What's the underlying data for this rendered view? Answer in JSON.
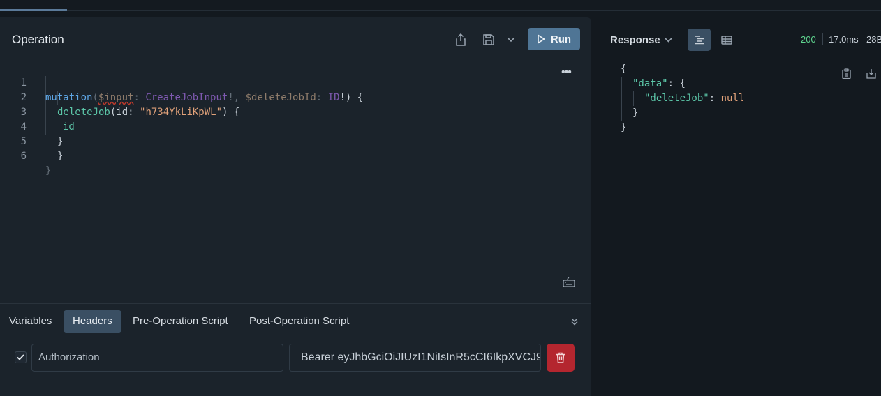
{
  "operation": {
    "title": "Operation",
    "run_label": "Run",
    "lines": [
      {
        "n": "1"
      },
      {
        "n": "2"
      },
      {
        "n": "3"
      },
      {
        "n": "4"
      },
      {
        "n": "5"
      },
      {
        "n": "6"
      }
    ],
    "code": {
      "l1_kw": "mutation",
      "l1_p1": "(",
      "l1_v1": "$input",
      "l1_c1": ": ",
      "l1_t1": "CreateJobInput",
      "l1_b1": "!, ",
      "l1_v2": "$deleteJobId",
      "l1_c2": ": ",
      "l1_t2": "ID",
      "l1_b2": "!) {",
      "l2_fn": "deleteJob",
      "l2_p1": "(",
      "l2_arg": "id",
      "l2_c": ": ",
      "l2_str": "\"h734YkLiKpWL\"",
      "l2_p2": ") {",
      "l3_field": "id",
      "l4": "}",
      "l5": "}",
      "l6": "}"
    }
  },
  "bottom_tabs": [
    {
      "label": "Variables"
    },
    {
      "label": "Headers"
    },
    {
      "label": "Pre-Operation Script"
    },
    {
      "label": "Post-Operation Script"
    }
  ],
  "header_row": {
    "enabled": true,
    "key": "Authorization",
    "value": "Bearer eyJhbGciOiJIUzI1NiIsInR5cCI6IkpXVCJ9"
  },
  "response": {
    "title": "Response",
    "status": "200",
    "time": "17.0ms",
    "size": "28B",
    "json": {
      "open": "{",
      "data_key": "\"data\"",
      "colon": ": ",
      "data_open": "{",
      "job_key": "\"deleteJob\"",
      "job_val": "null",
      "data_close": "}",
      "close": "}"
    }
  },
  "colors": {
    "accent": "#4f7595",
    "status_ok": "#5fd48f",
    "danger": "#b4262f"
  }
}
